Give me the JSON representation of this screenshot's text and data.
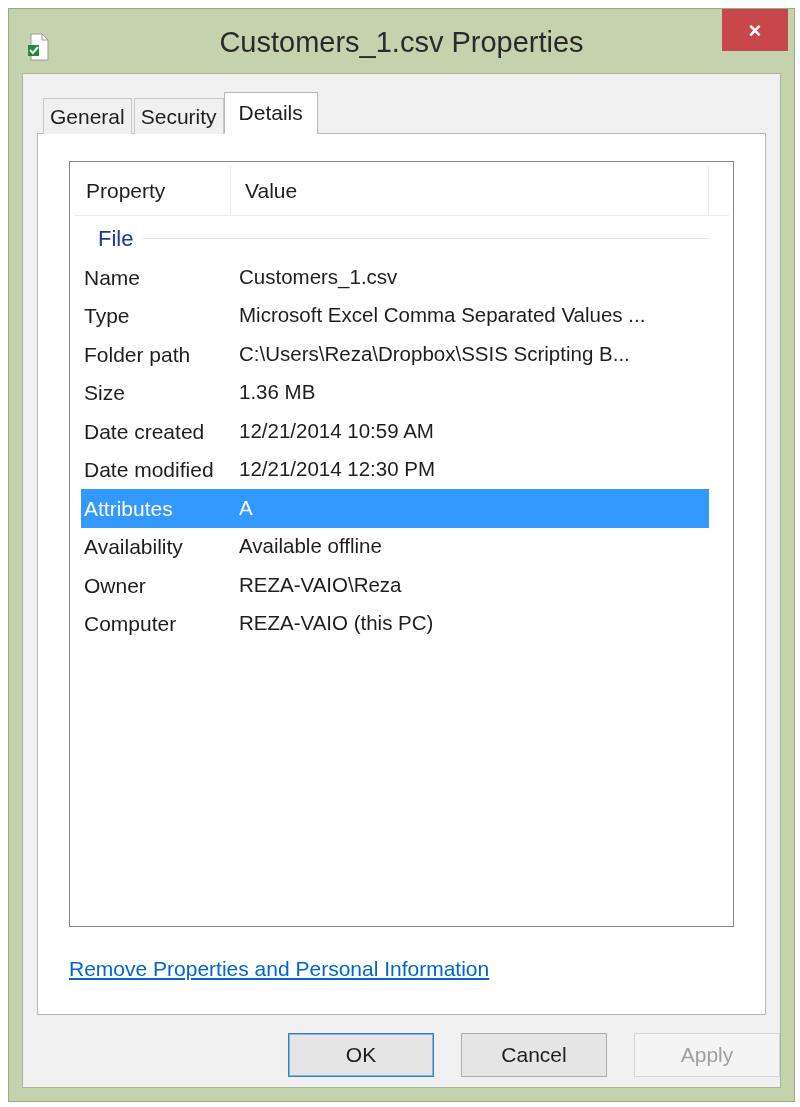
{
  "window": {
    "title": "Customers_1.csv Properties",
    "close": "×"
  },
  "tabs": [
    {
      "label": "General",
      "selected": false
    },
    {
      "label": "Security",
      "selected": false
    },
    {
      "label": "Details",
      "selected": true
    }
  ],
  "table": {
    "columns": [
      "Property",
      "Value"
    ],
    "group": "File",
    "rows": [
      {
        "property": "Name",
        "value": "Customers_1.csv",
        "selected": false
      },
      {
        "property": "Type",
        "value": "Microsoft Excel Comma Separated Values ...",
        "selected": false
      },
      {
        "property": "Folder path",
        "value": "C:\\Users\\Reza\\Dropbox\\SSIS Scripting B...",
        "selected": false
      },
      {
        "property": "Size",
        "value": "1.36 MB",
        "selected": false
      },
      {
        "property": "Date created",
        "value": "12/21/2014 10:59 AM",
        "selected": false
      },
      {
        "property": "Date modified",
        "value": "12/21/2014 12:30 PM",
        "selected": false
      },
      {
        "property": "Attributes",
        "value": "A",
        "selected": true
      },
      {
        "property": "Availability",
        "value": "Available offline",
        "selected": false
      },
      {
        "property": "Owner",
        "value": "REZA-VAIO\\Reza",
        "selected": false
      },
      {
        "property": "Computer",
        "value": "REZA-VAIO (this PC)",
        "selected": false
      }
    ]
  },
  "link": "Remove Properties and Personal Information",
  "buttons": [
    {
      "label": "OK",
      "default": true,
      "disabled": false
    },
    {
      "label": "Cancel",
      "default": false,
      "disabled": false
    },
    {
      "label": "Apply",
      "default": false,
      "disabled": true
    }
  ]
}
